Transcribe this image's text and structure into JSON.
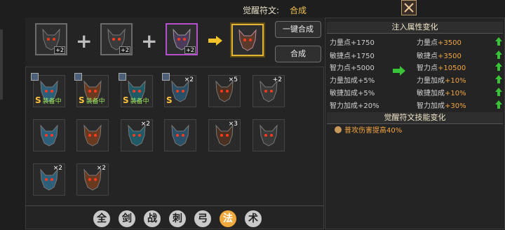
{
  "header": {
    "label": "觉醒符文:",
    "value": "合成"
  },
  "combine": {
    "slots": [
      {
        "badge": "+2",
        "border": "gray"
      },
      {
        "badge": "+2",
        "border": "gray"
      },
      {
        "badge": "+2",
        "border": "purple"
      }
    ],
    "plus_glyph": "+",
    "one_click_label": "一键合成",
    "combine_label": "合成"
  },
  "grid": [
    {
      "count": "",
      "equipped": true,
      "equip_text": "装备中",
      "grade": "S"
    },
    {
      "count": "",
      "equipped": true,
      "equip_text": "装备中",
      "grade": "S"
    },
    {
      "count": "",
      "equipped": true,
      "equip_text": "装备中",
      "grade": "S"
    },
    {
      "count": "×2",
      "equipped": false,
      "equip_text": "",
      "grade": "S"
    },
    {
      "count": "×5",
      "equipped": false,
      "equip_text": "",
      "grade": ""
    },
    {
      "count": "+2",
      "equipped": false,
      "equip_text": "",
      "grade": ""
    },
    {
      "count": "",
      "equipped": false,
      "equip_text": "",
      "grade": ""
    },
    {
      "count": "",
      "equipped": false,
      "equip_text": "",
      "grade": ""
    },
    {
      "count": "×2",
      "equipped": false,
      "equip_text": "",
      "grade": ""
    },
    {
      "count": "",
      "equipped": false,
      "equip_text": "",
      "grade": ""
    },
    {
      "count": "×3",
      "equipped": false,
      "equip_text": "",
      "grade": ""
    },
    {
      "count": "",
      "equipped": false,
      "equip_text": "",
      "grade": ""
    },
    {
      "count": "×2",
      "equipped": false,
      "equip_text": "",
      "grade": ""
    },
    {
      "count": "×2",
      "equipped": false,
      "equip_text": "",
      "grade": ""
    }
  ],
  "tabs": [
    "全",
    "剑",
    "战",
    "刺",
    "弓",
    "法",
    "术"
  ],
  "active_tab": "法",
  "attr_title": "注入属性变化",
  "stats_before": [
    {
      "name": "力量点",
      "value": "+1750"
    },
    {
      "name": "敏捷点",
      "value": "+1750"
    },
    {
      "name": "智力点",
      "value": "+5000"
    },
    {
      "name": "力量加成",
      "value": "+5%"
    },
    {
      "name": "敏捷加成",
      "value": "+5%"
    },
    {
      "name": "智力加成",
      "value": "+20%"
    }
  ],
  "stats_after": [
    {
      "name": "力量点",
      "value": "+3500"
    },
    {
      "name": "敏捷点",
      "value": "+3500"
    },
    {
      "name": "智力点",
      "value": "+10500"
    },
    {
      "name": "力量加成",
      "value": "+10%"
    },
    {
      "name": "敏捷加成",
      "value": "+10%"
    },
    {
      "name": "智力加成",
      "value": "+30%"
    }
  ],
  "skill_title": "觉醒符文技能变化",
  "skill_text": "普攻伤害提高40%",
  "colors": {
    "accent": "#f2a640",
    "up_arrow": "#37c437",
    "gold": "#e2b435",
    "purple": "#b44fd0"
  }
}
